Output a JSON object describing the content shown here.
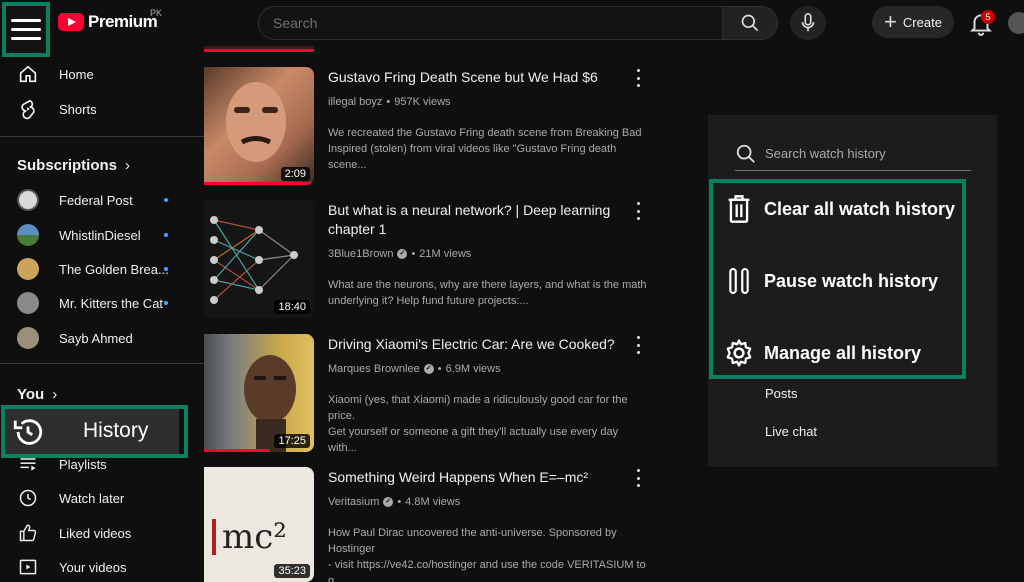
{
  "topbar": {
    "logo_text": "Premium",
    "country": "PK",
    "search_placeholder": "Search",
    "create_label": "Create",
    "notification_count": "5"
  },
  "sidebar": {
    "items_top": [
      {
        "label": "Home",
        "icon": "home-icon"
      },
      {
        "label": "Shorts",
        "icon": "shorts-icon"
      }
    ],
    "subscriptions_heading": "Subscriptions",
    "subscriptions": [
      {
        "label": "Federal Post",
        "color": "#d8d8d8"
      },
      {
        "label": "WhistlinDiesel",
        "color": "#5a8fbf"
      },
      {
        "label": "The Golden Brea...",
        "color": "#c9a45a"
      },
      {
        "label": "Mr. Kitters the Cat",
        "color": "#8a8a8a"
      },
      {
        "label": "Sayb Ahmed",
        "color": "#9b8e7a"
      }
    ],
    "you_heading": "You",
    "history_label": "History",
    "you_items": [
      {
        "label": "Playlists",
        "icon": "playlists-icon"
      },
      {
        "label": "Watch later",
        "icon": "clock-icon"
      },
      {
        "label": "Liked videos",
        "icon": "thumbs-up-icon"
      },
      {
        "label": "Your videos",
        "icon": "play-square-icon"
      }
    ]
  },
  "videos": [
    {
      "title": "Gustavo Fring Death Scene but We Had $6",
      "channel": "illegal boyz",
      "views": "957K views",
      "verified": false,
      "desc1": "We recreated the Gustavo Fring death scene from Breaking Bad",
      "desc2": "Inspired (stolen) from viral videos like \"Gustavo Fring death scene...",
      "duration": "2:09"
    },
    {
      "title": "But what is a neural network? | Deep learning chapter 1",
      "channel": "3Blue1Brown",
      "views": "21M views",
      "verified": true,
      "desc1": "What are the neurons, why are there layers, and what is the math",
      "desc2": "underlying it? Help fund future projects:...",
      "duration": "18:40"
    },
    {
      "title": "Driving Xiaomi's Electric Car: Are we Cooked?",
      "channel": "Marques Brownlee",
      "views": "6.9M views",
      "verified": true,
      "desc1": "Xiaomi (yes, that Xiaomi) made a ridiculously good car for the price.",
      "desc2": "Get yourself or someone a gift they'll actually use every day with...",
      "duration": "17:25"
    },
    {
      "title": "Something Weird Happens When E=–mc²",
      "channel": "Veritasium",
      "views": "4.8M views",
      "verified": true,
      "desc1": "How Paul Dirac uncovered the anti-universe. Sponsored by Hostinger",
      "desc2": "- visit https://ve42.co/hostinger and use the code VERITASIUM to g...",
      "duration": "35:23",
      "thumb_text": "mc²"
    }
  ],
  "panel": {
    "search_placeholder": "Search watch history",
    "actions": [
      {
        "label": "Clear all watch history",
        "icon": "trash-icon"
      },
      {
        "label": "Pause watch history",
        "icon": "pause-icon"
      },
      {
        "label": "Manage all history",
        "icon": "gear-icon"
      }
    ],
    "links": [
      "Posts",
      "Live chat"
    ]
  },
  "colors": {
    "highlight": "#0b8060",
    "accent_red": "#ff0033",
    "live_dot": "#3ea6ff"
  }
}
